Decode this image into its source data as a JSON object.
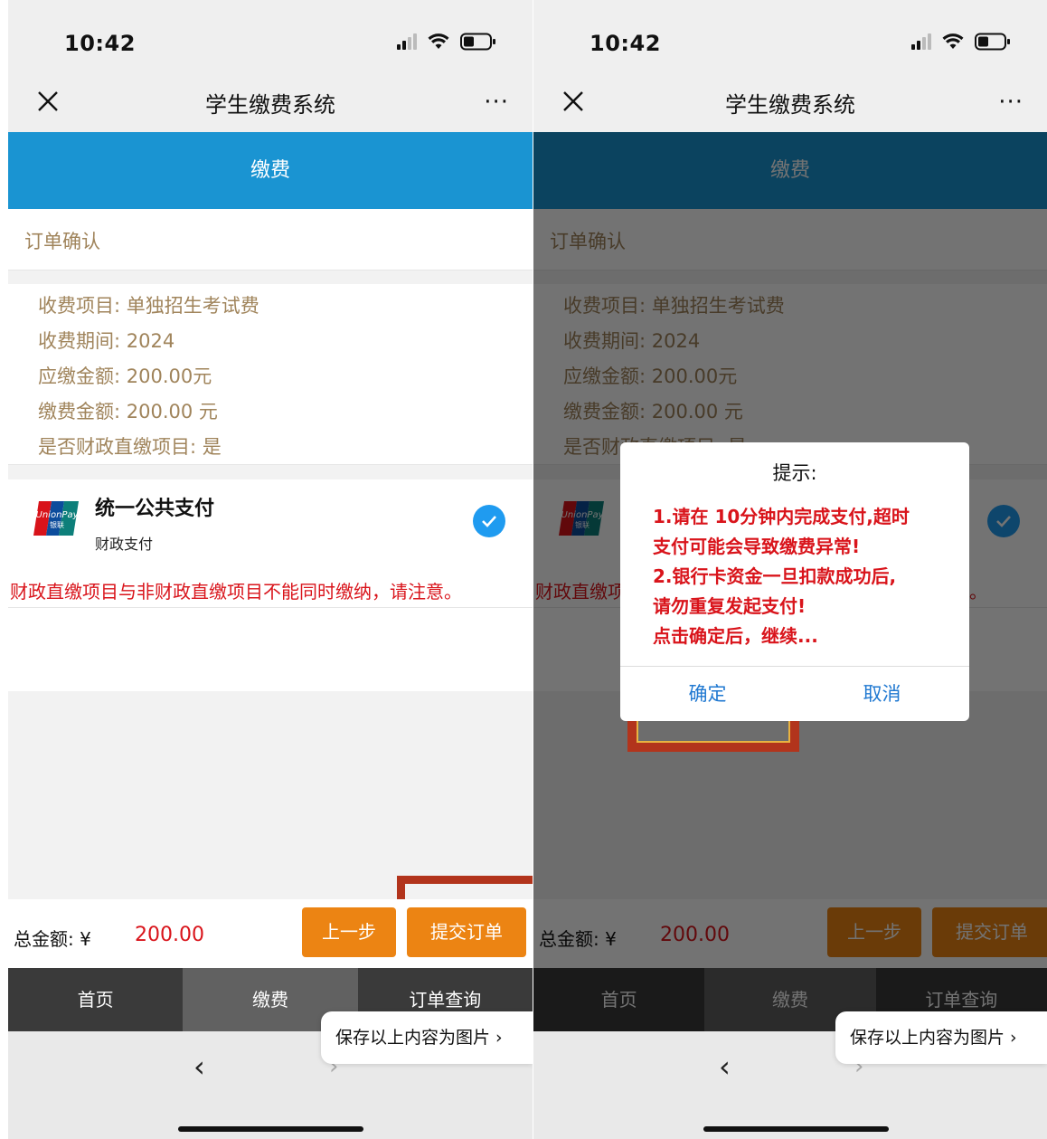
{
  "status": {
    "time": "10:42"
  },
  "nav": {
    "title": "学生缴费系统",
    "more": "···"
  },
  "header": {
    "title": "缴费"
  },
  "section": {
    "title": "订单确认"
  },
  "details": [
    "收费项目: 单独招生考试费",
    "收费期间: 2024",
    "应缴金额: 200.00元",
    "缴费金额: 200.00 元",
    "是否财政直缴项目: 是"
  ],
  "payment": {
    "title": "统一公共支付",
    "subtitle": "财政支付",
    "logo_line1": "UnionPay",
    "logo_line2": "银联",
    "selected": true
  },
  "notice": "财政直缴项目与非财政直缴项目不能同时缴纳，请注意。",
  "total": {
    "label": "总金额: ¥",
    "value": "200.00"
  },
  "buttons": {
    "prev": "上一步",
    "submit": "提交订单"
  },
  "tabs": [
    {
      "label": "首页",
      "active": false
    },
    {
      "label": "缴费",
      "active": true
    },
    {
      "label": "订单查询",
      "active": false
    }
  ],
  "save_bubble": "保存以上内容为图片 ›",
  "dialog": {
    "title": "提示:",
    "lines": [
      "1.请在 10分钟内完成支付,超时",
      "支付可能会导致缴费异常!",
      "2.银行卡资金一旦扣款成功后,",
      "请勿重复发起支付!",
      "点击确定后，继续..."
    ],
    "ok": "确定",
    "cancel": "取消"
  },
  "colors": {
    "brand_blue": "#1a94d2",
    "orange": "#ec8413",
    "red": "#d9141b",
    "gold_text": "#a0845b",
    "annotation_red": "#b2341c"
  }
}
